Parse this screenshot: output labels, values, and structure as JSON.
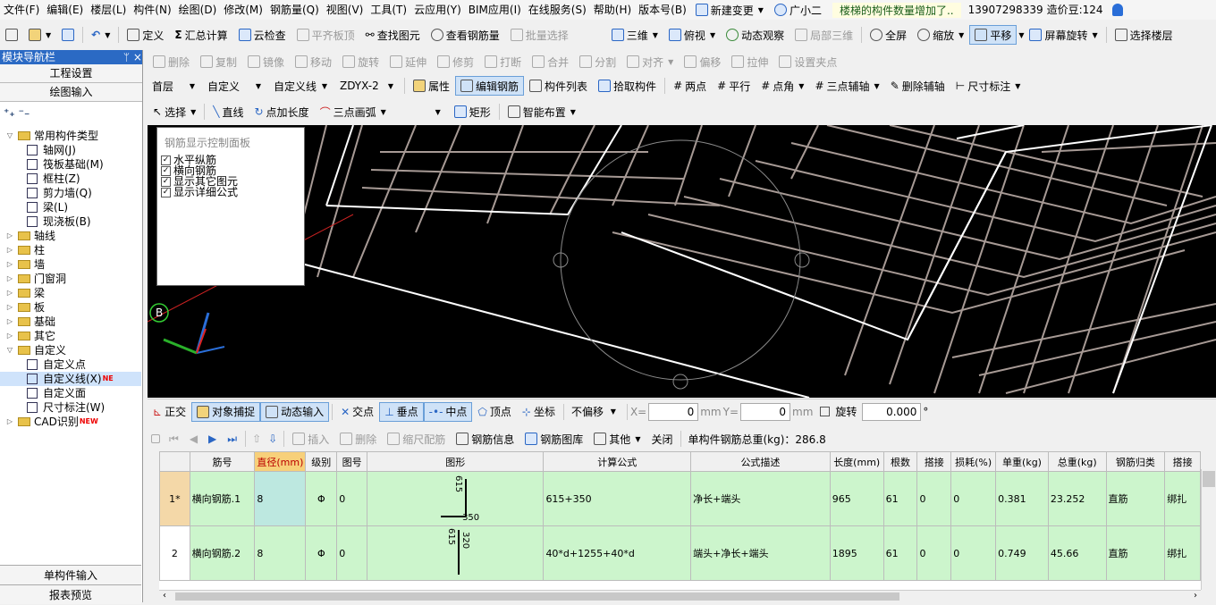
{
  "menu": {
    "items": [
      "文件(F)",
      "编辑(E)",
      "楼层(L)",
      "构件(N)",
      "绘图(D)",
      "修改(M)",
      "钢筋量(Q)",
      "视图(V)",
      "工具(T)",
      "云应用(Y)",
      "BIM应用(I)",
      "在线服务(S)",
      "帮助(H)",
      "版本号(B)"
    ],
    "new_change": "新建变更",
    "assistant": "广小二",
    "notice": "楼梯的构件数量增加了..",
    "phone": "13907298339",
    "cost": "造价豆:124"
  },
  "toolbar1": {
    "define": "定义",
    "summary": "汇总计算",
    "cloud_check": "云检查",
    "flat_top": "平齐板顶",
    "find": "查找图元",
    "view_rebar": "查看钢筋量",
    "batch_select": "批量选择",
    "view3d": "三维",
    "topview": "俯视",
    "dynamic": "动态观察",
    "local3d": "局部三维",
    "fullscreen": "全屏",
    "zoom": "缩放",
    "pan": "平移",
    "rotate": "屏幕旋转",
    "select_floor": "选择楼层"
  },
  "left_panel": {
    "title": "模块导航栏",
    "pin": "ᛘ ×",
    "project_settings": "工程设置",
    "drawing_input": "绘图输入",
    "single_input": "单构件输入",
    "report_preview": "报表预览",
    "tree": [
      {
        "label": "常用构件类型",
        "level": 0,
        "type": "folder",
        "expanded": true
      },
      {
        "label": "轴网(J)",
        "level": 1,
        "type": "leaf"
      },
      {
        "label": "筏板基础(M)",
        "level": 1,
        "type": "leaf"
      },
      {
        "label": "框柱(Z)",
        "level": 1,
        "type": "leaf"
      },
      {
        "label": "剪力墙(Q)",
        "level": 1,
        "type": "leaf"
      },
      {
        "label": "梁(L)",
        "level": 1,
        "type": "leaf"
      },
      {
        "label": "现浇板(B)",
        "level": 1,
        "type": "leaf"
      },
      {
        "label": "轴线",
        "level": 0,
        "type": "folder"
      },
      {
        "label": "柱",
        "level": 0,
        "type": "folder"
      },
      {
        "label": "墙",
        "level": 0,
        "type": "folder"
      },
      {
        "label": "门窗洞",
        "level": 0,
        "type": "folder"
      },
      {
        "label": "梁",
        "level": 0,
        "type": "folder"
      },
      {
        "label": "板",
        "level": 0,
        "type": "folder"
      },
      {
        "label": "基础",
        "level": 0,
        "type": "folder"
      },
      {
        "label": "其它",
        "level": 0,
        "type": "folder"
      },
      {
        "label": "自定义",
        "level": 0,
        "type": "folder",
        "expanded": true
      },
      {
        "label": "自定义点",
        "level": 1,
        "type": "leaf"
      },
      {
        "label": "自定义线(X)",
        "level": 1,
        "type": "leaf",
        "selected": true,
        "tag": "NE"
      },
      {
        "label": "自定义面",
        "level": 1,
        "type": "leaf"
      },
      {
        "label": "尺寸标注(W)",
        "level": 1,
        "type": "leaf"
      },
      {
        "label": "CAD识别",
        "level": 0,
        "type": "folder",
        "tag": "NEW"
      }
    ]
  },
  "edit_toolbar": {
    "delete": "删除",
    "copy": "复制",
    "mirror": "镜像",
    "move": "移动",
    "rotate": "旋转",
    "extend": "延伸",
    "trim": "修剪",
    "break": "打断",
    "merge": "合并",
    "split": "分割",
    "align": "对齐",
    "offset": "偏移",
    "stretch": "拉伸",
    "set_grip": "设置夹点"
  },
  "prop_toolbar": {
    "floor": "首层",
    "category": "自定义",
    "type": "自定义线",
    "name": "ZDYX-2",
    "attributes": "属性",
    "edit_rebar": "编辑钢筋",
    "member_list": "构件列表",
    "pick_member": "拾取构件",
    "two_points": "两点",
    "parallel": "平行",
    "point_angle": "点角",
    "three_point_aux": "三点辅轴",
    "delete_aux": "删除辅轴",
    "dimension": "尺寸标注"
  },
  "draw_toolbar": {
    "select": "选择",
    "line": "直线",
    "point_length": "点加长度",
    "three_arc": "三点画弧",
    "rect": "矩形",
    "smart_layout": "智能布置"
  },
  "control_panel": {
    "title": "钢筋显示控制面板",
    "options": [
      {
        "label": "水平纵筋",
        "checked": true
      },
      {
        "label": "横向钢筋",
        "checked": true
      },
      {
        "label": "显示其它图元",
        "checked": true
      },
      {
        "label": "显示详细公式",
        "checked": true
      }
    ]
  },
  "canvas": {
    "axis_label": "B"
  },
  "status_bar": {
    "ortho": "正交",
    "snap": "对象捕捉",
    "dynamic_input": "动态输入",
    "intersection": "交点",
    "perpendicular": "垂点",
    "midpoint": "中点",
    "vertex": "顶点",
    "coordinate": "坐标",
    "offset_mode": "不偏移",
    "x_label": "X=",
    "x_value": "0",
    "unit1": "mm",
    "y_label": "Y=",
    "y_value": "0",
    "unit2": "mm",
    "rotate_label": "旋转",
    "rotate_value": "0.000",
    "degree": "°"
  },
  "grid_toolbar": {
    "insert": "插入",
    "delete": "删除",
    "scale_rebar": "缩尺配筋",
    "rebar_info": "钢筋信息",
    "rebar_library": "钢筋图库",
    "other": "其他",
    "close": "关闭",
    "total_weight": "单构件钢筋总重(kg)：286.8"
  },
  "rebar_table": {
    "columns": [
      "筋号",
      "直径(mm)",
      "级别",
      "图号",
      "图形",
      "计算公式",
      "公式描述",
      "长度(mm)",
      "根数",
      "搭接",
      "损耗(%)",
      "单重(kg)",
      "总重(kg)",
      "钢筋归类",
      "搭接"
    ],
    "rows": [
      {
        "row": "1*",
        "name": "横向钢筋.1",
        "diameter": "8",
        "grade": "Φ",
        "fig": "0",
        "shape_top": "615",
        "shape_right": "350",
        "formula": "615+350",
        "desc": "净长+端头",
        "length": "965",
        "count": "61",
        "lap": "0",
        "loss": "0",
        "unit_w": "0.381",
        "total_w": "23.252",
        "category": "直筋",
        "lap_type": "绑扎"
      },
      {
        "row": "2",
        "name": "横向钢筋.2",
        "diameter": "8",
        "grade": "Φ",
        "fig": "0",
        "shape_top": "615",
        "shape_right": "320",
        "formula": "40*d+1255+40*d",
        "desc": "端头+净长+端头",
        "length": "1895",
        "count": "61",
        "lap": "0",
        "loss": "0",
        "unit_w": "0.749",
        "total_w": "45.66",
        "category": "直筋",
        "lap_type": "绑扎"
      }
    ]
  }
}
